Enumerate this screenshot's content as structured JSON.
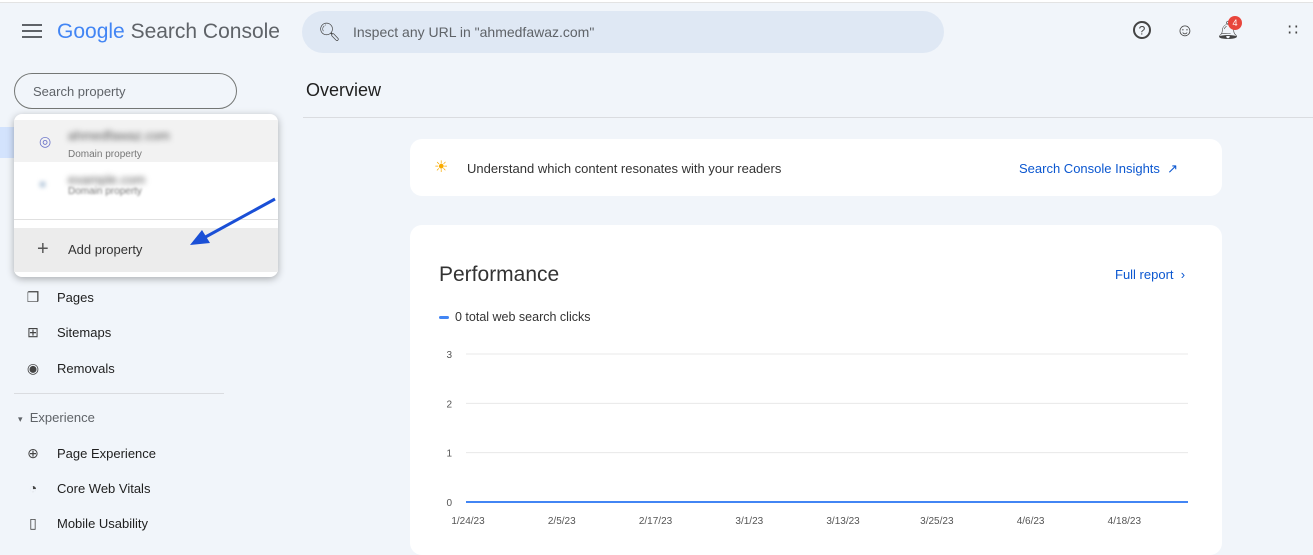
{
  "header": {
    "logo_google": "Google",
    "logo_product": "Search Console",
    "search_placeholder": "Inspect any URL in \"ahmedfawaz.com\"",
    "notifications_count": "4"
  },
  "sidebar": {
    "search_placeholder": "Search property",
    "properties": [
      {
        "name": "ahmedfawaz.com",
        "type": "Domain property"
      },
      {
        "name": "example.com",
        "type": "Domain property"
      }
    ],
    "add_property": "Add property",
    "items": [
      {
        "label": "Pages",
        "icon": "pages-icon"
      },
      {
        "label": "Sitemaps",
        "icon": "sitemap-icon"
      },
      {
        "label": "Removals",
        "icon": "eye-off-icon"
      }
    ],
    "experience_section": "Experience",
    "experience_items": [
      {
        "label": "Page Experience",
        "icon": "plus-circle-icon"
      },
      {
        "label": "Core Web Vitals",
        "icon": "gauge-icon"
      },
      {
        "label": "Mobile Usability",
        "icon": "phone-icon"
      }
    ]
  },
  "main": {
    "title": "Overview",
    "insight": {
      "text": "Understand which content resonates with your readers",
      "link": "Search Console Insights"
    },
    "performance": {
      "title": "Performance",
      "full_report": "Full report",
      "legend": "0 total web search clicks"
    }
  },
  "chart_data": {
    "type": "line",
    "series": [
      {
        "name": "0 total web search clicks",
        "values": [
          0,
          0,
          0,
          0,
          0,
          0,
          0,
          0
        ]
      }
    ],
    "x_ticks": [
      "1/24/23",
      "2/5/23",
      "2/17/23",
      "3/1/23",
      "3/13/23",
      "3/25/23",
      "4/6/23",
      "4/18/23"
    ],
    "y_ticks": [
      "0",
      "1",
      "2",
      "3"
    ],
    "ylim": [
      0,
      3
    ],
    "grid": true,
    "color": "#4285f4"
  }
}
